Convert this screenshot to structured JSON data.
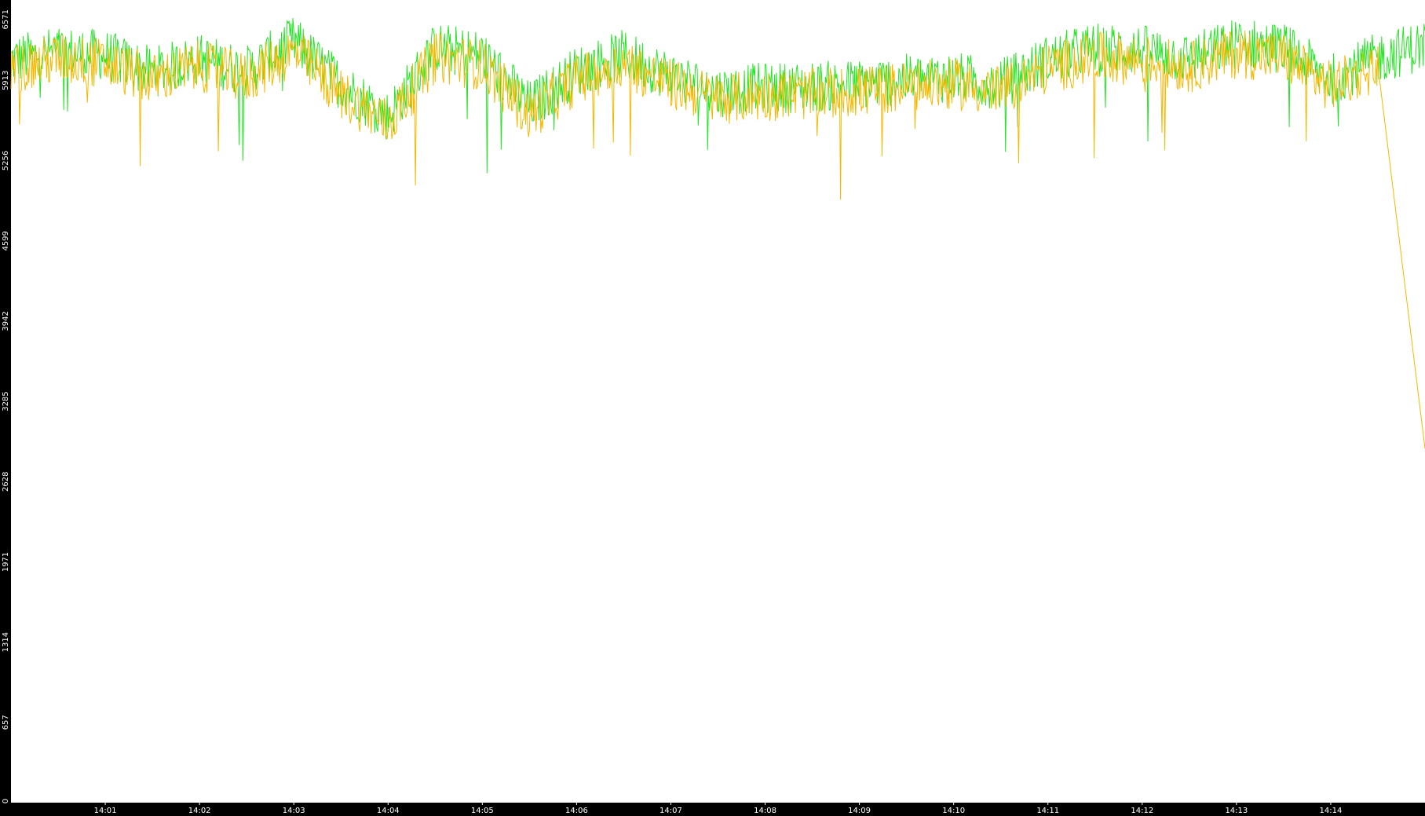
{
  "colors": {
    "background": "#000000",
    "plot_area": "#ffffff",
    "series_green": "#22e622",
    "series_orange": "#f5b800",
    "tick_text": "#ffffff"
  },
  "chart_data": {
    "type": "line",
    "title": "",
    "xlabel": "",
    "ylabel": "",
    "grid": false,
    "legend": "none",
    "ylim": [
      0,
      6571
    ],
    "xlim": [
      "14:00:00",
      "14:15:00"
    ],
    "y_ticks": [
      "0",
      "657",
      "1314",
      "1971",
      "2628",
      "3285",
      "3942",
      "4599",
      "5256",
      "5913",
      "6571"
    ],
    "y_tick_values": [
      0,
      657,
      1314,
      1971,
      2628,
      3285,
      3942,
      4599,
      5256,
      5913,
      6571
    ],
    "x_ticks": [
      "14:01",
      "14:02",
      "14:03",
      "14:04",
      "14:05",
      "14:06",
      "14:07",
      "14:08",
      "14:09",
      "14:10",
      "14:11",
      "14:12",
      "14:13",
      "14:14"
    ],
    "series": [
      {
        "color": "#22e622",
        "x": [
          "14:00:00",
          "14:00:30",
          "14:01:00",
          "14:01:30",
          "14:02:00",
          "14:02:30",
          "14:03:00",
          "14:03:30",
          "14:04:00",
          "14:04:30",
          "14:05:00",
          "14:05:30",
          "14:06:00",
          "14:06:30",
          "14:07:00",
          "14:07:30",
          "14:08:00",
          "14:08:30",
          "14:09:00",
          "14:09:30",
          "14:10:00",
          "14:10:30",
          "14:11:00",
          "14:11:30",
          "14:12:00",
          "14:12:30",
          "14:13:00",
          "14:13:30",
          "14:14:00",
          "14:14:30",
          "14:15:00"
        ],
        "values": [
          6080,
          6150,
          6120,
          5980,
          6090,
          5990,
          6230,
          5880,
          5620,
          6180,
          6120,
          5700,
          5990,
          6120,
          5950,
          5820,
          5850,
          5860,
          5880,
          5920,
          5940,
          5880,
          6080,
          6180,
          6160,
          6090,
          6220,
          6180,
          5920,
          6100,
          6200
        ]
      },
      {
        "color": "#f5b800",
        "x": [
          "14:00:00",
          "14:00:30",
          "14:01:00",
          "14:01:30",
          "14:02:00",
          "14:02:30",
          "14:03:00",
          "14:03:30",
          "14:04:00",
          "14:04:30",
          "14:05:00",
          "14:05:30",
          "14:06:00",
          "14:06:30",
          "14:07:00",
          "14:07:30",
          "14:08:00",
          "14:08:30",
          "14:09:00",
          "14:09:30",
          "14:10:00",
          "14:10:30",
          "14:11:00",
          "14:11:30",
          "14:12:00",
          "14:12:30",
          "14:13:00",
          "14:13:30",
          "14:14:00",
          "14:14:30",
          "14:15:00"
        ],
        "values": [
          6000,
          6090,
          6050,
          5920,
          6030,
          5930,
          6150,
          5800,
          5560,
          6100,
          6040,
          5620,
          5920,
          6050,
          5880,
          5760,
          5790,
          5800,
          5820,
          5860,
          5880,
          5820,
          6010,
          6100,
          6080,
          6020,
          6140,
          6100,
          5860,
          6030,
          2900
        ]
      }
    ]
  }
}
